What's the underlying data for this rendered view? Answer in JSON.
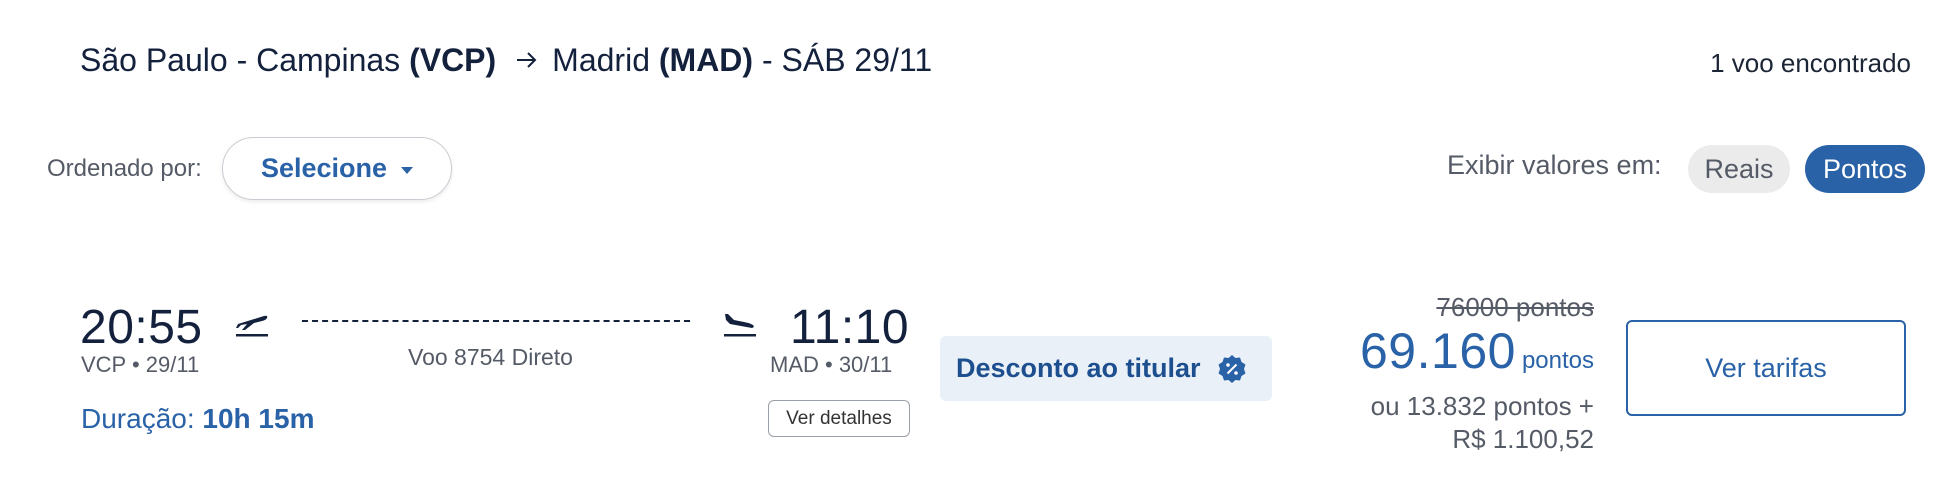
{
  "header": {
    "origin_city": "São Paulo - Campinas",
    "origin_code": "(VCP)",
    "arrow_icon": "arrow-right-icon",
    "destination_city": "Madrid",
    "destination_code": "(MAD)",
    "date": "- SÁB 29/11",
    "result_count": "1 voo encontrado"
  },
  "sort": {
    "label": "Ordenado por:",
    "select_value": "Selecione",
    "icon": "chevron-down-icon"
  },
  "display_toggle": {
    "label": "Exibir valores em:",
    "options": [
      "Reais",
      "Pontos"
    ],
    "selected": "Pontos"
  },
  "flight": {
    "departure_time": "20:55",
    "departure_place": "VCP • 29/11",
    "departure_icon": "plane-takeoff-icon",
    "flight_info": "Voo 8754 Direto",
    "arrival_icon": "plane-landing-icon",
    "arrival_time": "11:10",
    "arrival_place": "MAD • 30/11",
    "duration_label": "Duração:",
    "duration_value": "10h 15m",
    "details_button": "Ver detalhes",
    "discount_label": "Desconto ao titular",
    "discount_icon": "discount-badge-icon",
    "old_price": "76000 pontos",
    "price": "69.160",
    "price_unit": "pontos",
    "mixed_price_line1": "ou 13.832 pontos +",
    "mixed_price_line2": "R$ 1.100,52",
    "fares_button": "Ver tarifas"
  },
  "colors": {
    "accent": "#2a62a8",
    "text_dark": "#14213d",
    "text_muted": "#555b66",
    "discount_bg": "#eaf0f8",
    "toggle_inactive_bg": "#ebebeb"
  }
}
